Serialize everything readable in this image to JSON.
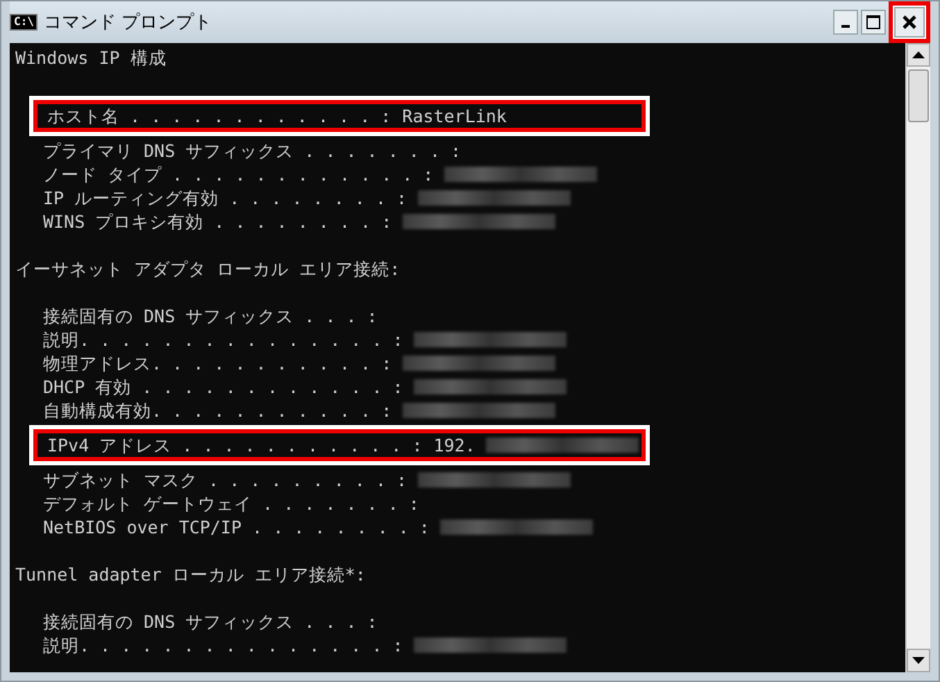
{
  "window": {
    "title": "コマンド プロンプト",
    "icon_text": "C:\\",
    "close_highlighted": true
  },
  "console": {
    "lines": [
      {
        "kind": "heading",
        "text": "Windows IP 構成"
      },
      {
        "kind": "blank"
      },
      {
        "kind": "field",
        "label": "ホスト名 . . . . . . . . . . . . :",
        "value": "RasterLink",
        "redacted": false,
        "highlighted": true
      },
      {
        "kind": "field",
        "label": "プライマリ DNS サフィックス . . . . . . . :",
        "redacted": false,
        "highlighted": false
      },
      {
        "kind": "field",
        "label": "ノード タイプ . . . . . . . . . . . . :",
        "redacted": true,
        "highlighted": false
      },
      {
        "kind": "field",
        "label": "IP ルーティング有効 . . . . . . . . :",
        "redacted": true,
        "highlighted": false
      },
      {
        "kind": "field",
        "label": "WINS プロキシ有効 . . . . . . . . :",
        "redacted": true,
        "highlighted": false
      },
      {
        "kind": "blank"
      },
      {
        "kind": "heading",
        "text": "イーサネット アダプタ ローカル エリア接続:"
      },
      {
        "kind": "blank"
      },
      {
        "kind": "field",
        "label": "接続固有の DNS サフィックス . . . :",
        "redacted": false,
        "highlighted": false
      },
      {
        "kind": "field",
        "label": "説明. . . . . . . . . . . . . . . :",
        "redacted": true,
        "highlighted": false
      },
      {
        "kind": "field",
        "label": "物理アドレス. . . . . . . . . . . :",
        "redacted": true,
        "highlighted": false
      },
      {
        "kind": "field",
        "label": "DHCP 有効 . . . . . . . . . . . . :",
        "redacted": true,
        "highlighted": false
      },
      {
        "kind": "field",
        "label": "自動構成有効. . . . . . . . . . . :",
        "redacted": true,
        "highlighted": false
      },
      {
        "kind": "field",
        "label": "IPv4 アドレス . . . . . . . . . . . :",
        "value": "192.",
        "redacted": true,
        "highlighted": true
      },
      {
        "kind": "field",
        "label": "サブネット マスク . . . . . . . . . :",
        "redacted": true,
        "highlighted": false
      },
      {
        "kind": "field",
        "label": "デフォルト ゲートウェイ . . . . . . . :",
        "redacted": false,
        "highlighted": false
      },
      {
        "kind": "field",
        "label": "NetBIOS over TCP/IP . . . . . . . . :",
        "redacted": true,
        "highlighted": false
      },
      {
        "kind": "blank"
      },
      {
        "kind": "heading",
        "text": "Tunnel adapter ローカル エリア接続*:"
      },
      {
        "kind": "blank"
      },
      {
        "kind": "field",
        "label": "接続固有の DNS サフィックス . . . :",
        "redacted": false,
        "highlighted": false
      },
      {
        "kind": "field",
        "label": "説明. . . . . . . . . . . . . . . :",
        "redacted": true,
        "highlighted": false
      }
    ]
  }
}
